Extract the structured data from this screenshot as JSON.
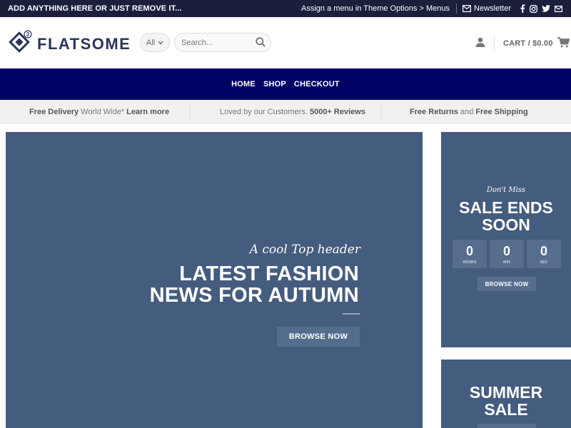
{
  "topbar": {
    "promo": "ADD ANYTHING HERE OR JUST REMOVE IT...",
    "menu_link": "Assign a menu in Theme Options > Menus",
    "newsletter": "Newsletter"
  },
  "header": {
    "logo_text": "FLATSOME",
    "logo_badge": "3",
    "category_select": "All",
    "search_placeholder": "Search...",
    "cart_label": "CART / $0.00"
  },
  "nav": {
    "items": [
      {
        "label": "HOME"
      },
      {
        "label": "SHOP"
      },
      {
        "label": "CHECKOUT"
      }
    ]
  },
  "usp": {
    "item1": {
      "bold1": "Free Delivery",
      "text": " World Wide* ",
      "bold2": "Learn more"
    },
    "item2": {
      "text": "Loved by our Customers. ",
      "bold": "5000+ Reviews"
    },
    "item3": {
      "bold1": "Free Returns",
      "text": " and ",
      "bold2": "Free Shipping"
    }
  },
  "hero": {
    "pre_title": "A cool Top header",
    "title_line1": "LATEST FASHION",
    "title_line2": "NEWS FOR AUTUMN",
    "button": "BROWSE NOW"
  },
  "sale": {
    "small": "Don't Miss",
    "title_line1": "SALE ENDS",
    "title_line2": "SOON",
    "countdown": [
      {
        "value": "0",
        "label": "HOURS"
      },
      {
        "value": "0",
        "label": "MIN"
      },
      {
        "value": "0",
        "label": "SEC"
      }
    ],
    "button": "BROWSE NOW"
  },
  "summer": {
    "title_line1": "SUMMER",
    "title_line2": "SALE"
  },
  "colors": {
    "topbar_bg": "#1b1f3c",
    "nav_bg": "#010264",
    "banner_bg": "#445c7e",
    "logo": "#2b3558"
  }
}
